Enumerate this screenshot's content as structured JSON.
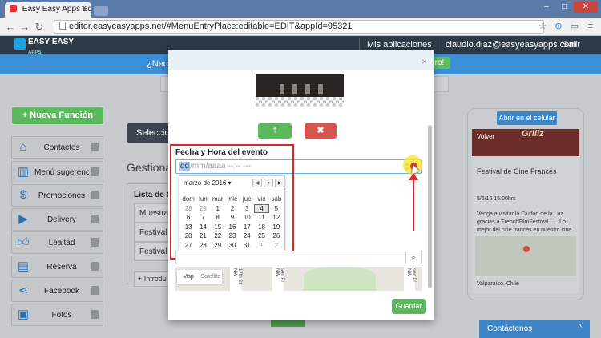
{
  "browser": {
    "tab_title": "Easy Easy Apps Editor",
    "url": "editor.easyeasyapps.net/#MenuEntryPlace:editable=EDIT&appId=95321"
  },
  "app": {
    "logo_line1": "EASY EASY",
    "logo_line2": "APPS",
    "my_apps": "Mis aplicaciones",
    "user_email": "claudio.diaz@easyeasyapps.com",
    "logout": "Salir"
  },
  "banner": {
    "text": "¿Nece",
    "pro_label": "Pro!"
  },
  "sidebar": {
    "new_function": "+ Nueva Función",
    "items": [
      {
        "label": "Contactos",
        "icon": "home-icon"
      },
      {
        "label": "Menú sugerenci...",
        "icon": "book-icon"
      },
      {
        "label": "Promociones",
        "icon": "dollar-icon"
      },
      {
        "label": "Delivery",
        "icon": "truck-icon"
      },
      {
        "label": "Lealtad",
        "icon": "thumbs-up-icon"
      },
      {
        "label": "Reserva",
        "icon": "ticket-icon"
      },
      {
        "label": "Facebook",
        "icon": "share-icon"
      },
      {
        "label": "Fotos",
        "icon": "image-icon"
      }
    ]
  },
  "main": {
    "select_button": "Seleccion",
    "manage_title": "Gestionar",
    "list_header": "Lista de Co",
    "rows": [
      "Muestra",
      "Festival d",
      "Festival d"
    ],
    "intro_button": "+ Introdu"
  },
  "modal": {
    "close": "×",
    "upload_icon": "upload-icon",
    "delete_icon": "delete-icon",
    "date_label": "Fecha y Hora del evento",
    "date_placeholder_sel": "dd",
    "date_placeholder_rest": "/mm/aaaa --:-- ---",
    "calendar": {
      "month_label": "marzo de 2016 ▾",
      "weekdays": [
        "dom",
        "lun",
        "mar",
        "mié",
        "jue",
        "vie",
        "sáb"
      ],
      "weeks": [
        [
          "28",
          "29",
          "1",
          "2",
          "3",
          "4",
          "5"
        ],
        [
          "6",
          "7",
          "8",
          "9",
          "10",
          "11",
          "12"
        ],
        [
          "13",
          "14",
          "15",
          "16",
          "17",
          "18",
          "19"
        ],
        [
          "20",
          "21",
          "22",
          "23",
          "24",
          "25",
          "26"
        ],
        [
          "27",
          "28",
          "29",
          "30",
          "31",
          "1",
          "2"
        ]
      ]
    },
    "map_types": [
      "Map",
      "Satellite"
    ],
    "street_labels": [
      "17th St NW",
      "son Pl NW",
      "son Pl NW"
    ],
    "save_button": "Guardar"
  },
  "phone": {
    "open_button": "Abrir en el celular",
    "back": "Volver",
    "banner_brand": "Grillz",
    "event_title": "Festival de Cine Francés",
    "event_date": "5/6/16 15:00hrs",
    "event_desc": "Venga a visitar la Ciudad de la Luz gracias a FrenchFilmFestival ! ... Lo mejor del cine francés en nuestro cine.",
    "location": "Valparaíso, Chile"
  },
  "contact": {
    "label": "Contáctenos"
  }
}
